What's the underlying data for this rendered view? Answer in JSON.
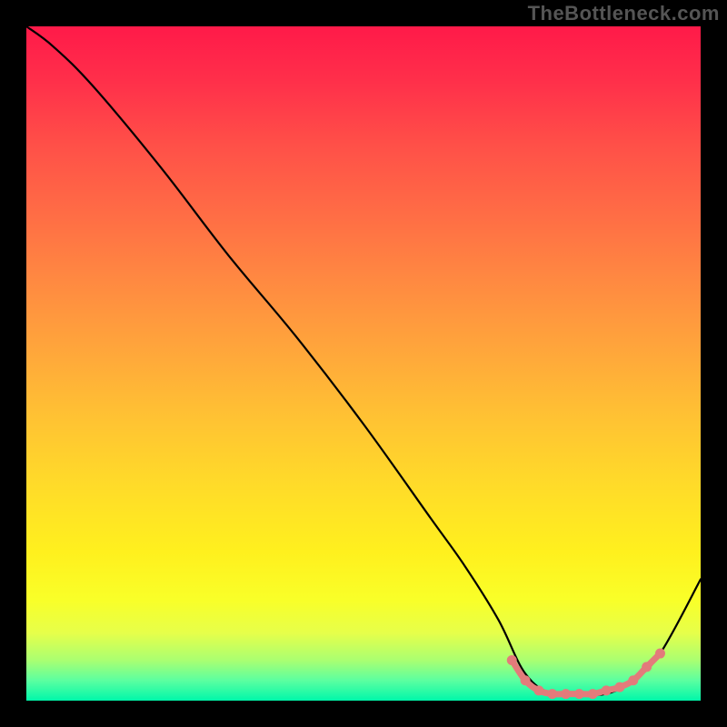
{
  "watermark": "TheBottleneck.com",
  "colors": {
    "background": "#000000",
    "gradient_top": "#ff1a49",
    "gradient_bottom": "#00f7aa",
    "curve": "#000000",
    "highlight": "#e37b7b",
    "watermark_text": "#555555"
  },
  "chart_data": {
    "type": "line",
    "title": "",
    "xlabel": "",
    "ylabel": "",
    "xlim": [
      0,
      100
    ],
    "ylim": [
      0,
      100
    ],
    "grid": false,
    "legend": false,
    "series": [
      {
        "name": "bottleneck-curve",
        "x": [
          0,
          4,
          10,
          20,
          30,
          40,
          50,
          60,
          65,
          70,
          74,
          78,
          82,
          86,
          90,
          94,
          100
        ],
        "y": [
          100,
          97,
          91,
          79,
          66,
          54,
          41,
          27,
          20,
          12,
          4,
          1,
          1,
          1,
          3,
          7,
          18
        ]
      }
    ],
    "highlight": {
      "x": [
        72,
        74,
        76,
        78,
        80,
        82,
        84,
        86,
        88,
        90,
        92,
        94
      ],
      "y": [
        6,
        3,
        1.5,
        1,
        1,
        1,
        1,
        1.5,
        2,
        3,
        5,
        7
      ]
    }
  }
}
